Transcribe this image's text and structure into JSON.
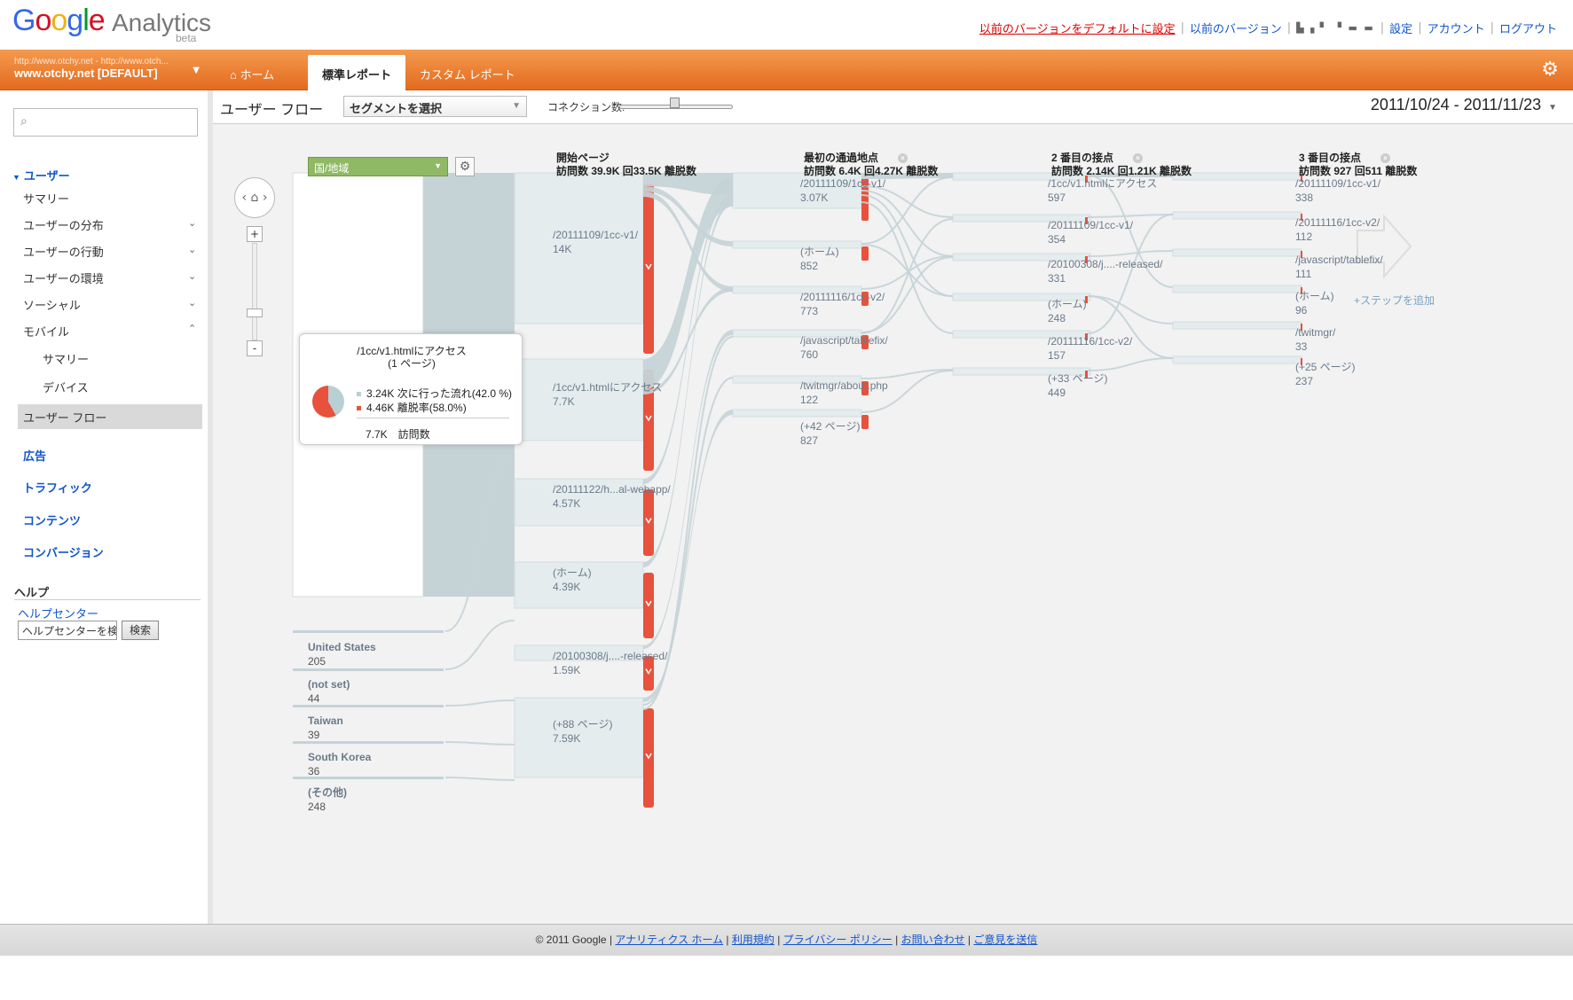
{
  "header": {
    "links": [
      "以前のバージョンをデフォルトに設定",
      "以前のバージョン",
      "設定",
      "アカウント",
      "ログアウト"
    ]
  },
  "logo": {
    "google": "Google",
    "analytics": "Analytics",
    "beta": "beta"
  },
  "nav": {
    "account_small": "http://www.otchy.net - http://www.otch...",
    "account_big": "www.otchy.net [DEFAULT]",
    "tabs": [
      "ホーム",
      "標準レポート",
      "カスタム レポート"
    ]
  },
  "sidebar": {
    "users": "ユーザー",
    "items": [
      "サマリー",
      "ユーザーの分布",
      "ユーザーの行動",
      "ユーザーの環境",
      "ソーシャル",
      "モバイル"
    ],
    "mobile_sub": [
      "サマリー",
      "デバイス"
    ],
    "active": "ユーザー フロー",
    "sections": [
      "広告",
      "トラフィック",
      "コンテンツ",
      "コンバージョン"
    ],
    "help": {
      "title": "ヘルプ",
      "link": "ヘルプセンター",
      "input_value": "ヘルプセンターを検索",
      "button": "検索"
    }
  },
  "toolbar": {
    "title": "ユーザー フロー",
    "segment": "セグメントを選択",
    "connections": "コネクション数:",
    "date_range": "2011/10/24 - 2011/11/23"
  },
  "flow": {
    "dimension": "国/地域",
    "add_step": "+ステップを追加",
    "columns": [
      {
        "title": "開始ページ",
        "stats": "訪問数 39.9K 回33.5K 離脱数"
      },
      {
        "title": "最初の通過地点",
        "stats": "訪問数 6.4K 回4.27K 離脱数"
      },
      {
        "title": "2 番目の接点",
        "stats": "訪問数 2.14K 回1.21K 離脱数"
      },
      {
        "title": "3 番目の接点",
        "stats": "訪問数 927 回511 離脱数"
      }
    ],
    "sources": [
      {
        "name": "United States",
        "value": "205"
      },
      {
        "name": "(not set)",
        "value": "44"
      },
      {
        "name": "Taiwan",
        "value": "39"
      },
      {
        "name": "South Korea",
        "value": "36"
      },
      {
        "name": "(その他)",
        "value": "248"
      }
    ],
    "start_pages": [
      {
        "name": "/20111109/1cc-v1/",
        "value": "14K"
      },
      {
        "name": "/1cc/v1.htmlにアクセス",
        "value": "7.7K"
      },
      {
        "name": "/20111122/h...al-webapp/",
        "value": "4.57K"
      },
      {
        "name": "(ホーム)",
        "value": "4.39K"
      },
      {
        "name": "/20100308/j....-released/",
        "value": "1.59K"
      },
      {
        "name": "(+88 ページ)",
        "value": "7.59K"
      }
    ],
    "step1": [
      {
        "name": "/20111109/1cc-v1/",
        "value": "3.07K"
      },
      {
        "name": "(ホーム)",
        "value": "852"
      },
      {
        "name": "/20111116/1cc-v2/",
        "value": "773"
      },
      {
        "name": "/javascript/tablefix/",
        "value": "760"
      },
      {
        "name": "/twitmgr/about.php",
        "value": "122"
      },
      {
        "name": "(+42 ページ)",
        "value": "827"
      }
    ],
    "step2": [
      {
        "name": "/1cc/v1.htmlにアクセス",
        "value": "597"
      },
      {
        "name": "/20111109/1cc-v1/",
        "value": "354"
      },
      {
        "name": "/20100308/j....-released/",
        "value": "331"
      },
      {
        "name": "(ホーム)",
        "value": "248"
      },
      {
        "name": "/20111116/1cc-v2/",
        "value": "157"
      },
      {
        "name": "(+33 ページ)",
        "value": "449"
      }
    ],
    "step3": [
      {
        "name": "/20111109/1cc-v1/",
        "value": "338"
      },
      {
        "name": "/20111116/1cc-v2/",
        "value": "112"
      },
      {
        "name": "/javascript/tablefix/",
        "value": "111"
      },
      {
        "name": "(ホーム)",
        "value": "96"
      },
      {
        "name": "/twitmgr/",
        "value": "33"
      },
      {
        "name": "(+25 ページ)",
        "value": "237"
      }
    ],
    "tooltip": {
      "title": "/1cc/v1.htmlにアクセス",
      "subtitle": "(1 ページ)",
      "next_flow": "3.24K 次に行った流れ(42.0 %)",
      "dropoff": "4.46K 離脱率(58.0%)",
      "visits": "7.7K　訪問数",
      "next_fraction": 0.42,
      "drop_fraction": 0.58
    }
  },
  "colors": {
    "orange": "#e8762b",
    "flow": "#c5d3d7",
    "dropoff": "#e8513c",
    "link": "#1155cc"
  },
  "footer": {
    "copyright": "© 2011 Google",
    "links": [
      "アナリティクス ホーム",
      "利用規約",
      "プライバシー ポリシー",
      "お問い合わせ",
      "ご意見を送信"
    ]
  }
}
